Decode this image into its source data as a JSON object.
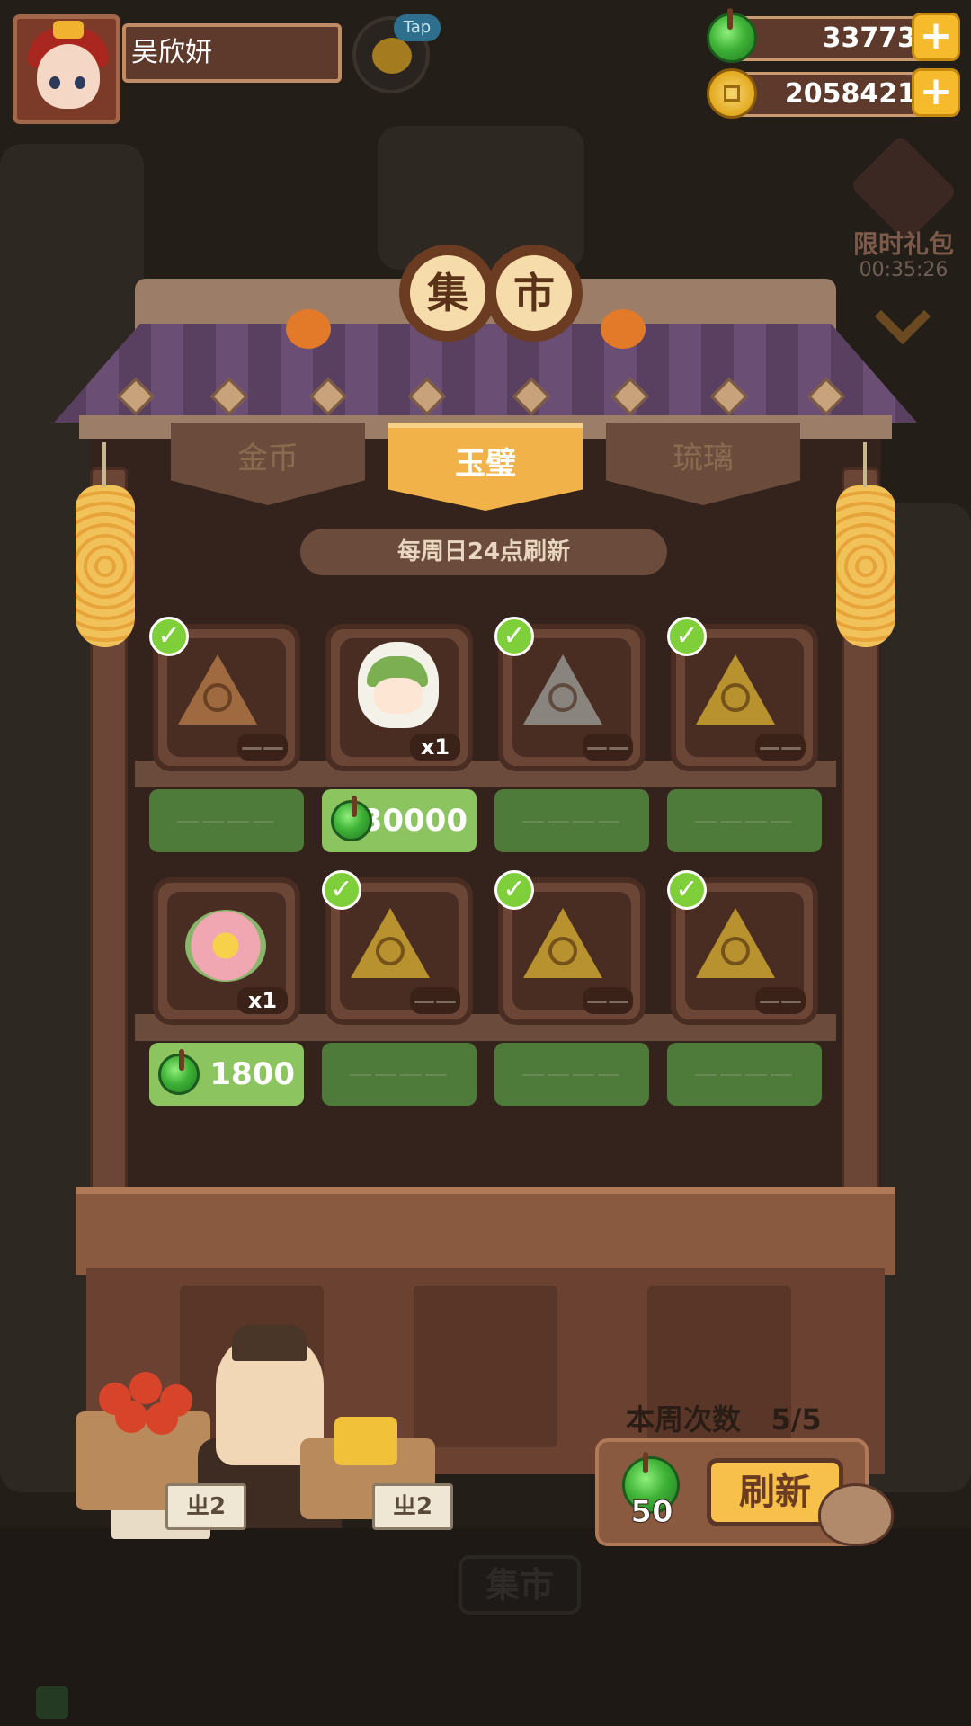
{
  "player": {
    "name": "吴欣妍"
  },
  "tap_badge": "Tap",
  "resources": {
    "jade": "33773",
    "coins": "2058421",
    "plus": "+"
  },
  "gift": {
    "label": "限时礼包",
    "timer": "00:35:26"
  },
  "title": {
    "char1": "集",
    "char2": "市"
  },
  "tabs": [
    {
      "label": "金币",
      "active": false
    },
    {
      "label": "玉璧",
      "active": true
    },
    {
      "label": "琉璃",
      "active": false
    }
  ],
  "notice": "每周日24点刷新",
  "check_mark": "✓",
  "rows": [
    {
      "items": [
        {
          "kind": "tri-brown",
          "qty": "——",
          "purchased": true
        },
        {
          "kind": "character",
          "qty": "x1",
          "purchased": false
        },
        {
          "kind": "tri-grey",
          "qty": "——",
          "purchased": true
        },
        {
          "kind": "tri-gold",
          "qty": "——",
          "purchased": true
        }
      ],
      "prices": [
        "————",
        "30000",
        "————",
        "————"
      ]
    },
    {
      "items": [
        {
          "kind": "flower",
          "qty": "x1",
          "purchased": false
        },
        {
          "kind": "tri-gold",
          "qty": "——",
          "purchased": true
        },
        {
          "kind": "tri-gold",
          "qty": "——",
          "purchased": true
        },
        {
          "kind": "tri-gold",
          "qty": "——",
          "purchased": true
        }
      ],
      "prices": [
        "1800",
        "————",
        "————",
        "————"
      ]
    }
  ],
  "stall_tags": {
    "left": "ㄓ2",
    "right": "ㄓ2",
    "sign": "钅"
  },
  "weekly": {
    "label": "本周次数",
    "count": "5/5"
  },
  "refresh": {
    "cost": "50",
    "label": "刷新"
  },
  "bottom_label": "集市",
  "colors": {
    "gem": "#3fb237",
    "coin": "#e3a91f",
    "active_tab": "#f2b24a",
    "price_active": "#8cc560",
    "price_inactive": "#4e7a3a"
  }
}
